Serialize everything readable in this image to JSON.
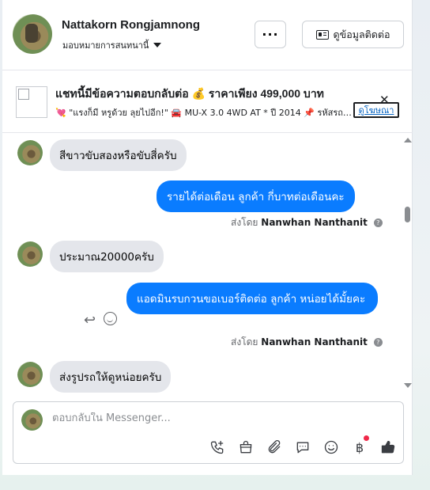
{
  "header": {
    "contact_name": "Nattakorn Rongjamnong",
    "assign_label": "มอบหมายการสนทนานี้",
    "more_label": "···",
    "contact_info_label": "ดูข้อมูลติดต่อ"
  },
  "ad": {
    "title": "แชทนี้มีข้อความตอบกลับต่อ 💰 ราคาเพียง 499,000 บาท",
    "subtitle": "💘 \"แรงก็มี หรูด้วย ลุยไปอีก!\" 🚘 MU-X 3.0 4WD AT * ปี 2014 📌 รหัสรถ…",
    "link_label": "ดูโฆษณา",
    "close_label": "✕"
  },
  "messages": [
    {
      "direction": "in",
      "text": "สีขาวขับสองหรือขับสี่ครับ"
    },
    {
      "direction": "out",
      "text": "รายได้ต่อเดือน ลูกค้า  กี่บาทต่อเดือนคะ"
    },
    {
      "sent_by_prefix": "ส่งโดย",
      "sent_by_name": "Nanwhan Nanthanit"
    },
    {
      "direction": "in",
      "text": "ประมาณ20000ครับ"
    },
    {
      "direction": "out",
      "text": "แอดมินรบกวนขอเบอร์ติดต่อ ลูกค้า หน่อยได้มั้ยคะ"
    },
    {
      "sent_by_prefix": "ส่งโดย",
      "sent_by_name": "Nanwhan Nanthanit"
    },
    {
      "direction": "in",
      "text": "ส่งรูปรถให้ดูหน่อยครับ"
    }
  ],
  "composer": {
    "placeholder": "ตอบกลับใน Messenger..."
  },
  "toolbar_icons": [
    "phone-plus-icon",
    "shopping-bag-icon",
    "attachment-icon",
    "saved-reply-icon",
    "emoji-icon",
    "baht-icon",
    "thumbs-up-icon"
  ],
  "colors": {
    "outgoing_bubble": "#0a7cff",
    "incoming_bubble": "#e4e6eb",
    "notification_dot": "#f02849"
  }
}
